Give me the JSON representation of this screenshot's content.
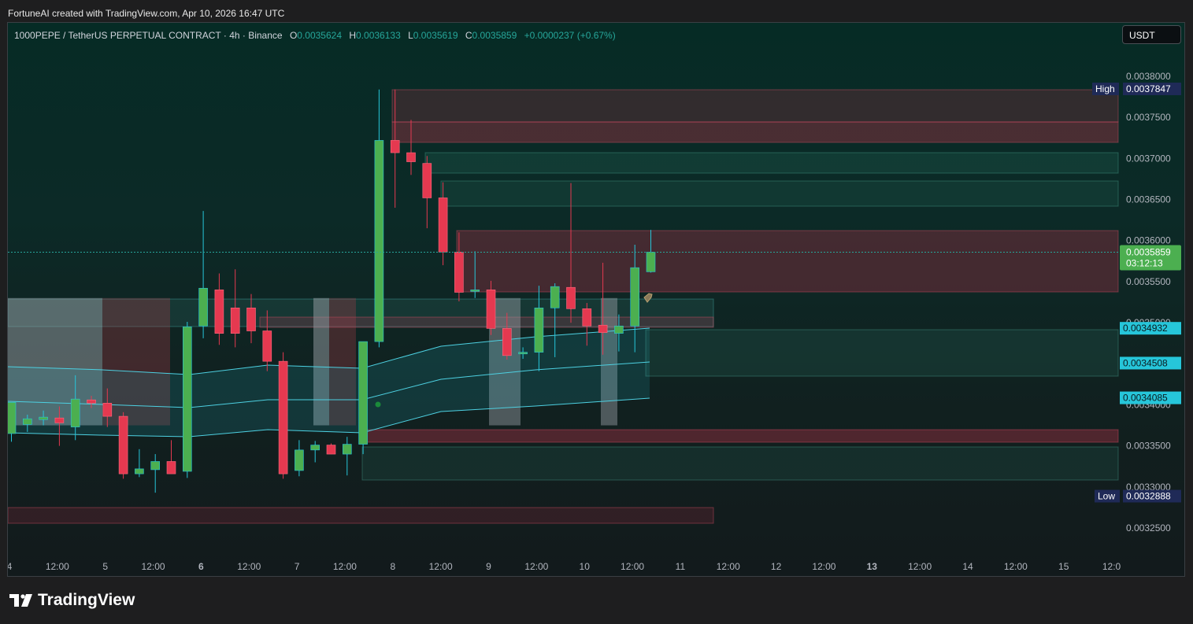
{
  "caption": "FortuneAI created with TradingView.com, Apr 10, 2026 16:47 UTC",
  "legend": {
    "symbol": "1000PEPE / TetherUS PERPETUAL CONTRACT · 4h · Binance",
    "o_label": "O",
    "o_value": "0.0035624",
    "h_label": "H",
    "h_value": "0.0036133",
    "l_label": "L",
    "l_value": "0.0035619",
    "c_label": "C",
    "c_value": "0.0035859",
    "change": "+0.0000237 (+0.67%)"
  },
  "currency": "USDT",
  "brand": "TradingView",
  "colors": {
    "up": "#4caf50",
    "down": "#e53950",
    "accent": "#26c6da",
    "high_low_tag": "#1f2a57",
    "last_price_tag": "#4caf50"
  },
  "chart_data": {
    "type": "candlestick",
    "y_ticks": [
      "0.0038000",
      "0.0037500",
      "0.0037000",
      "0.0036500",
      "0.0036000",
      "0.0035500",
      "0.0035000",
      "0.0034500",
      "0.0034000",
      "0.0033500",
      "0.0033000",
      "0.0032500"
    ],
    "x_ticks": [
      "4",
      "12:00",
      "5",
      "12:00",
      "6",
      "12:00",
      "7",
      "12:00",
      "8",
      "12:00",
      "9",
      "12:00",
      "10",
      "12:00",
      "11",
      "12:00",
      "12",
      "12:00",
      "13",
      "12:00",
      "14",
      "12:00",
      "15",
      "12:0"
    ],
    "candles": [
      {
        "o": 0.003365,
        "h": 0.003398,
        "l": 0.003355,
        "c": 0.003403
      },
      {
        "o": 0.003376,
        "h": 0.003388,
        "l": 0.003367,
        "c": 0.003383
      },
      {
        "o": 0.003382,
        "h": 0.003393,
        "l": 0.003375,
        "c": 0.003385
      },
      {
        "o": 0.003384,
        "h": 0.003398,
        "l": 0.00335,
        "c": 0.003378
      },
      {
        "o": 0.003373,
        "h": 0.003436,
        "l": 0.003357,
        "c": 0.003407
      },
      {
        "o": 0.003406,
        "h": 0.003411,
        "l": 0.003396,
        "c": 0.003402
      },
      {
        "o": 0.003402,
        "h": 0.00342,
        "l": 0.003373,
        "c": 0.003386
      },
      {
        "o": 0.003386,
        "h": 0.003391,
        "l": 0.00331,
        "c": 0.003316
      },
      {
        "o": 0.003316,
        "h": 0.003346,
        "l": 0.003312,
        "c": 0.003322
      },
      {
        "o": 0.003321,
        "h": 0.00334,
        "l": 0.003293,
        "c": 0.003331
      },
      {
        "o": 0.003331,
        "h": 0.003357,
        "l": 0.003317,
        "c": 0.003316
      },
      {
        "o": 0.003319,
        "h": 0.003501,
        "l": 0.003311,
        "c": 0.003495
      },
      {
        "o": 0.003496,
        "h": 0.003636,
        "l": 0.003481,
        "c": 0.003542
      },
      {
        "o": 0.00354,
        "h": 0.00356,
        "l": 0.003473,
        "c": 0.003487
      },
      {
        "o": 0.003518,
        "h": 0.003565,
        "l": 0.00347,
        "c": 0.003487
      },
      {
        "o": 0.003518,
        "h": 0.003535,
        "l": 0.003475,
        "c": 0.00349
      },
      {
        "o": 0.00349,
        "h": 0.003515,
        "l": 0.003441,
        "c": 0.003453
      },
      {
        "o": 0.003453,
        "h": 0.003464,
        "l": 0.00331,
        "c": 0.003316
      },
      {
        "o": 0.00332,
        "h": 0.003357,
        "l": 0.003313,
        "c": 0.003345
      },
      {
        "o": 0.003345,
        "h": 0.003356,
        "l": 0.00333,
        "c": 0.003351
      },
      {
        "o": 0.003351,
        "h": 0.003353,
        "l": 0.00334,
        "c": 0.00334
      },
      {
        "o": 0.00334,
        "h": 0.003361,
        "l": 0.003314,
        "c": 0.003352
      },
      {
        "o": 0.003352,
        "h": 0.003476,
        "l": 0.00334,
        "c": 0.003477
      },
      {
        "o": 0.003477,
        "h": 0.003784,
        "l": 0.00347,
        "c": 0.003722
      },
      {
        "o": 0.003722,
        "h": 0.003784,
        "l": 0.00364,
        "c": 0.003707
      },
      {
        "o": 0.003707,
        "h": 0.003747,
        "l": 0.00368,
        "c": 0.003696
      },
      {
        "o": 0.003694,
        "h": 0.003703,
        "l": 0.003615,
        "c": 0.003652
      },
      {
        "o": 0.003652,
        "h": 0.003671,
        "l": 0.00357,
        "c": 0.003586
      },
      {
        "o": 0.003586,
        "h": 0.00361,
        "l": 0.003526,
        "c": 0.003537
      },
      {
        "o": 0.003539,
        "h": 0.003587,
        "l": 0.00353,
        "c": 0.00354
      },
      {
        "o": 0.00354,
        "h": 0.003551,
        "l": 0.003485,
        "c": 0.003493
      },
      {
        "o": 0.003493,
        "h": 0.003512,
        "l": 0.003455,
        "c": 0.00346
      },
      {
        "o": 0.003462,
        "h": 0.00347,
        "l": 0.003456,
        "c": 0.003464
      },
      {
        "o": 0.003464,
        "h": 0.003545,
        "l": 0.003441,
        "c": 0.003518
      },
      {
        "o": 0.003518,
        "h": 0.003548,
        "l": 0.003458,
        "c": 0.003544
      },
      {
        "o": 0.003543,
        "h": 0.00367,
        "l": 0.0035,
        "c": 0.003517
      },
      {
        "o": 0.003517,
        "h": 0.003524,
        "l": 0.003472,
        "c": 0.003496
      },
      {
        "o": 0.003497,
        "h": 0.003573,
        "l": 0.003461,
        "c": 0.003488
      },
      {
        "o": 0.003487,
        "h": 0.00351,
        "l": 0.003465,
        "c": 0.003496
      },
      {
        "o": 0.003496,
        "h": 0.003595,
        "l": 0.003464,
        "c": 0.003567
      },
      {
        "o": 0.003562,
        "h": 0.003613,
        "l": 0.003561,
        "c": 0.003586
      }
    ],
    "last_price": "0.0035859",
    "countdown": "03:12:13",
    "high_label": "High",
    "high_value": "0.0037847",
    "low_label": "Low",
    "low_value": "0.0032888",
    "price_tags": [
      "0.0034932",
      "0.0034508",
      "0.0034085"
    ]
  }
}
